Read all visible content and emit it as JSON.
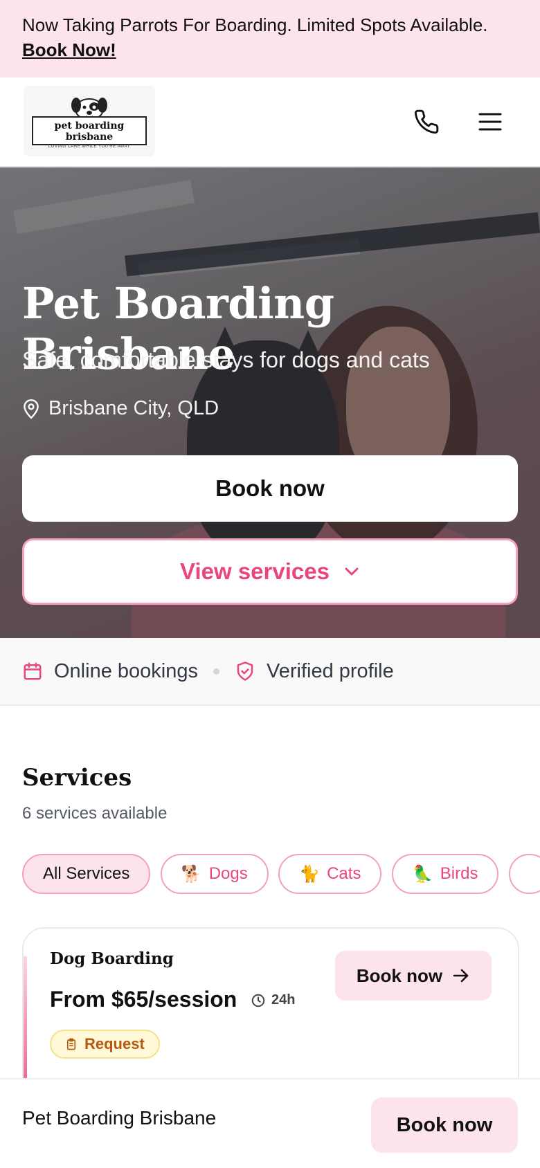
{
  "announcement": {
    "text": "Now Taking Parrots For Boarding. Limited Spots Available.",
    "link": "Book Now!"
  },
  "header": {
    "logo_title": "pet boarding brisbane",
    "logo_tagline": "LOVING CARE WHILE YOU'RE AWAY",
    "icons": [
      "phone-icon",
      "menu-icon"
    ]
  },
  "hero": {
    "title": "Pet Boarding Brisbane",
    "subtitle": "Safe, comfortable stays for dogs and cats",
    "location": "Brisbane City, QLD",
    "primary_button": "Book now",
    "secondary_button": "View services"
  },
  "trust": {
    "items": [
      "Online bookings",
      "Verified profile"
    ]
  },
  "services": {
    "title": "Services",
    "count": "6 services available",
    "filters": [
      {
        "label": "All Services",
        "emoji": "",
        "active": true
      },
      {
        "label": "Dogs",
        "emoji": "🐕",
        "active": false
      },
      {
        "label": "Cats",
        "emoji": "🐈",
        "active": false
      },
      {
        "label": "Birds",
        "emoji": "🦜",
        "active": false
      }
    ],
    "cards": [
      {
        "name": "Dog Boarding",
        "price": "From $65/session",
        "duration": "24h",
        "badge": "Request",
        "button": "Book now"
      }
    ]
  },
  "footer": {
    "name": "Pet Boarding Brisbane",
    "button": "Book now"
  },
  "colors": {
    "accent": "#e8467c",
    "accent_light": "#fde4ec",
    "accent_border": "#f4a0bb",
    "badge_text": "#b45a10"
  }
}
